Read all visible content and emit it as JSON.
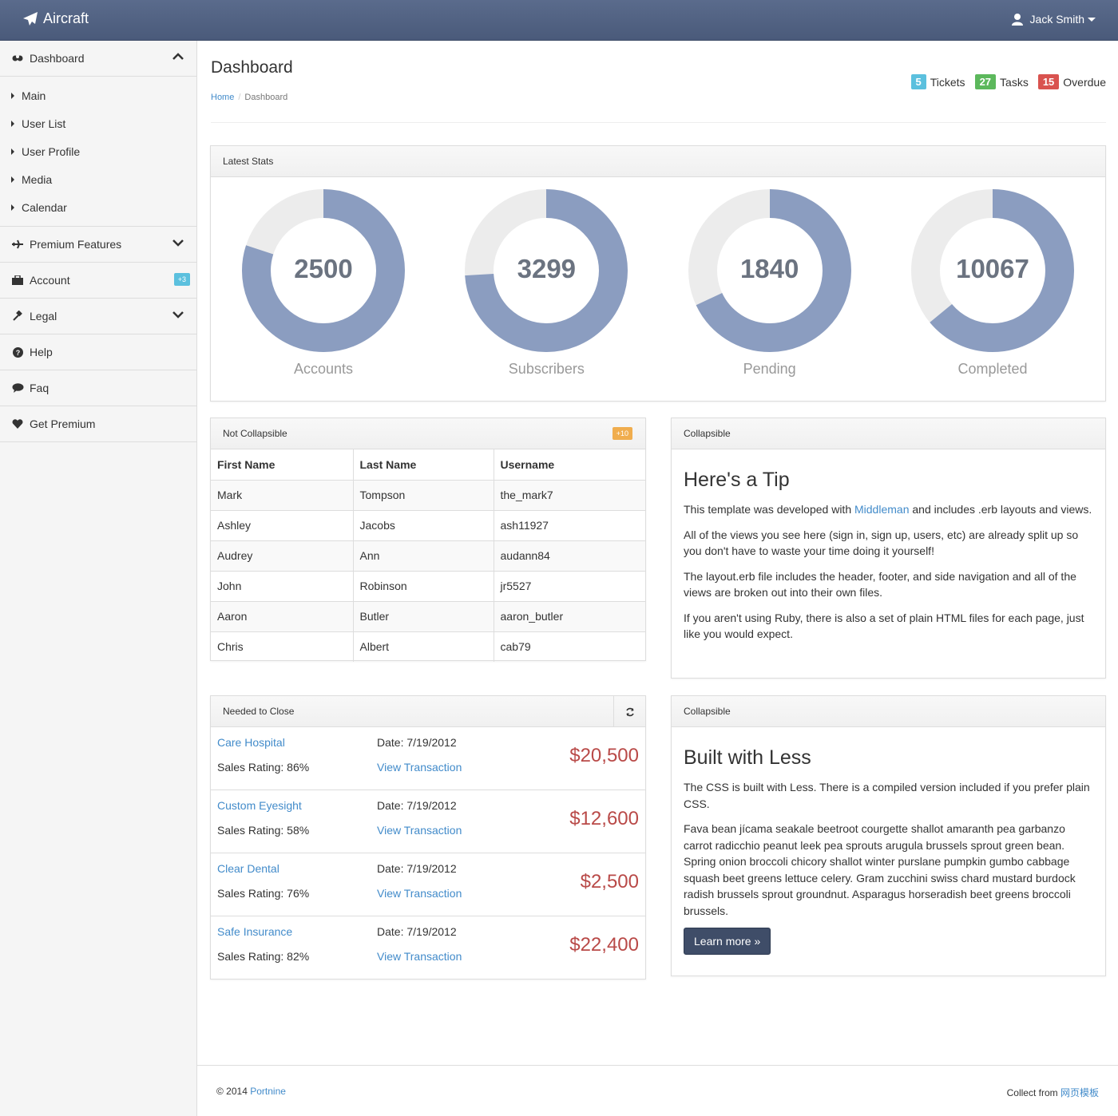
{
  "app": {
    "brand": "Aircraft",
    "user": "Jack Smith"
  },
  "sidebar": {
    "dashboard": "Dashboard",
    "sub_items": [
      "Main",
      "User List",
      "User Profile",
      "Media",
      "Calendar"
    ],
    "premium": "Premium Features",
    "account": "Account",
    "account_badge": "+3",
    "legal": "Legal",
    "help": "Help",
    "faq": "Faq",
    "get_premium": "Get Premium"
  },
  "header": {
    "title": "Dashboard",
    "breadcrumb": {
      "home": "Home",
      "current": "Dashboard"
    },
    "badges": [
      {
        "count": "5",
        "label": "Tickets",
        "color": "#5bc0de"
      },
      {
        "count": "27",
        "label": "Tasks",
        "color": "#5cb85c"
      },
      {
        "count": "15",
        "label": "Overdue",
        "color": "#d9534f"
      }
    ]
  },
  "stats": {
    "title": "Latest Stats",
    "ring_color": "#8b9dc0",
    "track_color": "#ececec",
    "items": [
      {
        "value": "2500",
        "label": "Accounts",
        "fraction": 0.8
      },
      {
        "value": "3299",
        "label": "Subscribers",
        "fraction": 0.74
      },
      {
        "value": "1840",
        "label": "Pending",
        "fraction": 0.68
      },
      {
        "value": "10067",
        "label": "Completed",
        "fraction": 0.64
      }
    ]
  },
  "table_panel": {
    "title": "Not Collapsible",
    "badge": "+10",
    "columns": [
      "First Name",
      "Last Name",
      "Username"
    ],
    "rows": [
      [
        "Mark",
        "Tompson",
        "the_mark7"
      ],
      [
        "Ashley",
        "Jacobs",
        "ash11927"
      ],
      [
        "Audrey",
        "Ann",
        "audann84"
      ],
      [
        "John",
        "Robinson",
        "jr5527"
      ],
      [
        "Aaron",
        "Butler",
        "aaron_butler"
      ],
      [
        "Chris",
        "Albert",
        "cab79"
      ]
    ]
  },
  "deals_panel": {
    "title": "Needed to Close",
    "deals": [
      {
        "name": "Care Hospital",
        "rating": "Sales Rating: 86%",
        "date": "Date: 7/19/2012",
        "link": "View Transaction",
        "amount": "$20,500"
      },
      {
        "name": "Custom Eyesight",
        "rating": "Sales Rating: 58%",
        "date": "Date: 7/19/2012",
        "link": "View Transaction",
        "amount": "$12,600"
      },
      {
        "name": "Clear Dental",
        "rating": "Sales Rating: 76%",
        "date": "Date: 7/19/2012",
        "link": "View Transaction",
        "amount": "$2,500"
      },
      {
        "name": "Safe Insurance",
        "rating": "Sales Rating: 82%",
        "date": "Date: 7/19/2012",
        "link": "View Transaction",
        "amount": "$22,400"
      }
    ]
  },
  "tip_panel": {
    "title": "Collapsible",
    "heading": "Here's a Tip",
    "p1_before": "This template was developed with ",
    "p1_link": "Middleman",
    "p1_after": " and includes .erb layouts and views.",
    "p2": "All of the views you see here (sign in, sign up, users, etc) are already split up so you don't have to waste your time doing it yourself!",
    "p3": "The layout.erb file includes the header, footer, and side navigation and all of the views are broken out into their own files.",
    "p4": "If you aren't using Ruby, there is also a set of plain HTML files for each page, just like you would expect."
  },
  "less_panel": {
    "title": "Collapsible",
    "heading": "Built with Less",
    "p1": "The CSS is built with Less. There is a compiled version included if you prefer plain CSS.",
    "p2": "Fava bean jícama seakale beetroot courgette shallot amaranth pea garbanzo carrot radicchio peanut leek pea sprouts arugula brussels sprout green bean. Spring onion broccoli chicory shallot winter purslane pumpkin gumbo cabbage squash beet greens lettuce celery. Gram zucchini swiss chard mustard burdock radish brussels sprout groundnut. Asparagus horseradish beet greens broccoli brussels.",
    "button": "Learn more »"
  },
  "footer": {
    "copy": "© 2014 ",
    "company": "Portnine",
    "collect": "Collect from ",
    "collect_link": "网页模板"
  }
}
